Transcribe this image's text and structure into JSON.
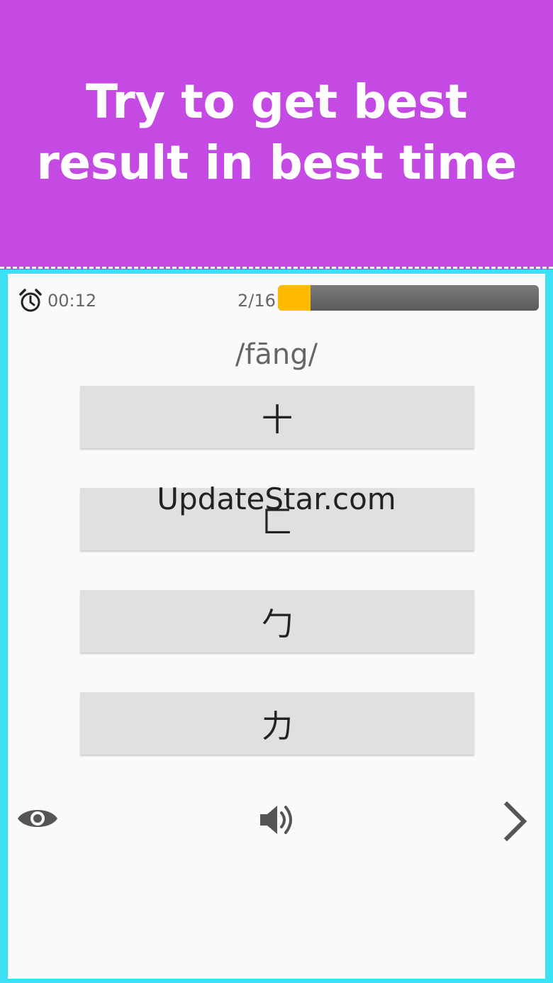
{
  "banner": {
    "text": "Try to get best result in best time",
    "background": "#c44ae3"
  },
  "quiz": {
    "timer": "00:12",
    "count": "2/16",
    "progress_fraction": 0.125,
    "pinyin": "/fāng/",
    "options": [
      "十",
      "匚",
      "勹",
      "力"
    ]
  },
  "watermark": "UpdateStar.com",
  "icons": {
    "clock": "alarm-clock-icon",
    "eye": "eye-icon",
    "speaker": "speaker-icon",
    "next": "chevron-right-icon"
  },
  "colors": {
    "frame": "#3be0f5",
    "progress_fill": "#ffbb00",
    "progress_track": "#666666"
  }
}
